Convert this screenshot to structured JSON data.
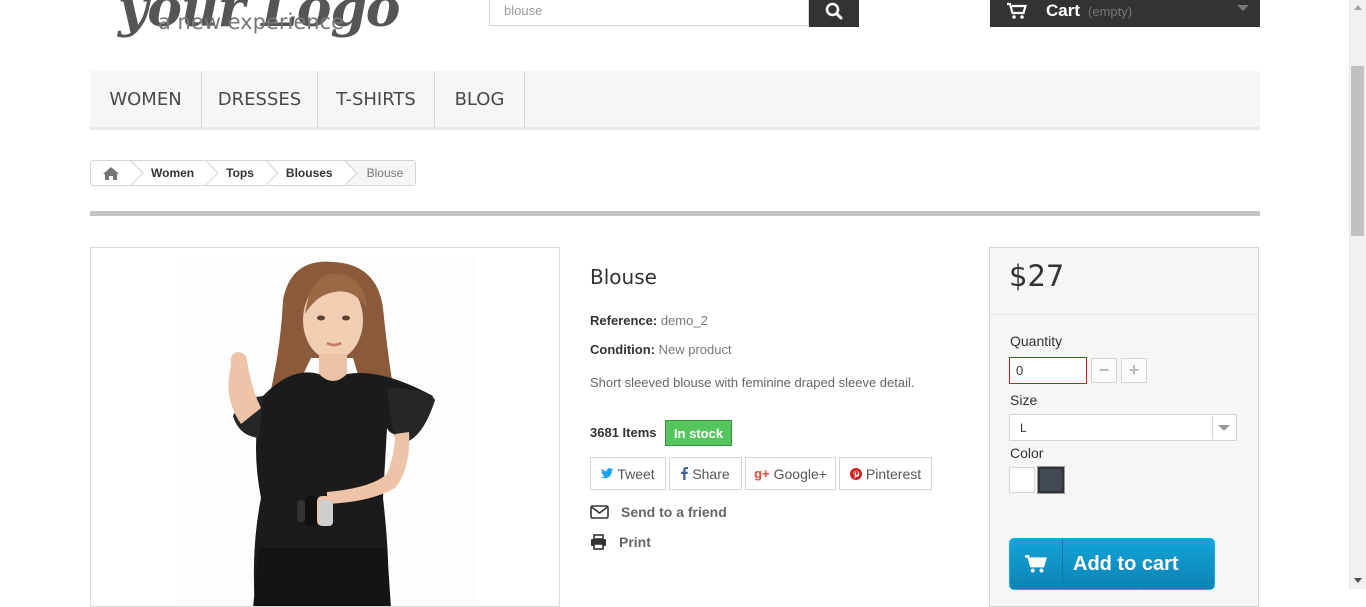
{
  "logo": {
    "tagline": "a new experience",
    "wordmark": "your Logo"
  },
  "search": {
    "value": "blouse",
    "icon": "search-icon"
  },
  "cart": {
    "label": "Cart",
    "status": "(empty)"
  },
  "menu": {
    "items": [
      "WOMEN",
      "DRESSES",
      "T-SHIRTS",
      "BLOG"
    ]
  },
  "breadcrumb": {
    "items": [
      "Women",
      "Tops",
      "Blouses"
    ],
    "current": "Blouse"
  },
  "product": {
    "title": "Blouse",
    "reference_label": "Reference:",
    "reference_value": "demo_2",
    "condition_label": "Condition:",
    "condition_value": "New product",
    "description": "Short sleeved blouse with feminine draped sleeve detail.",
    "items_count": "3681 Items",
    "stock_status": "In stock"
  },
  "share": {
    "tweet": "Tweet",
    "share": "Share",
    "google": "Google+",
    "pinterest": "Pinterest"
  },
  "actions": {
    "send_friend": "Send to a friend",
    "print": "Print"
  },
  "buy": {
    "price": "$27",
    "quantity_label": "Quantity",
    "quantity_value": "0",
    "size_label": "Size",
    "size_value": "L",
    "color_label": "Color",
    "colors": [
      "#ffffff",
      "#434a54"
    ],
    "add_to_cart": "Add to cart"
  }
}
